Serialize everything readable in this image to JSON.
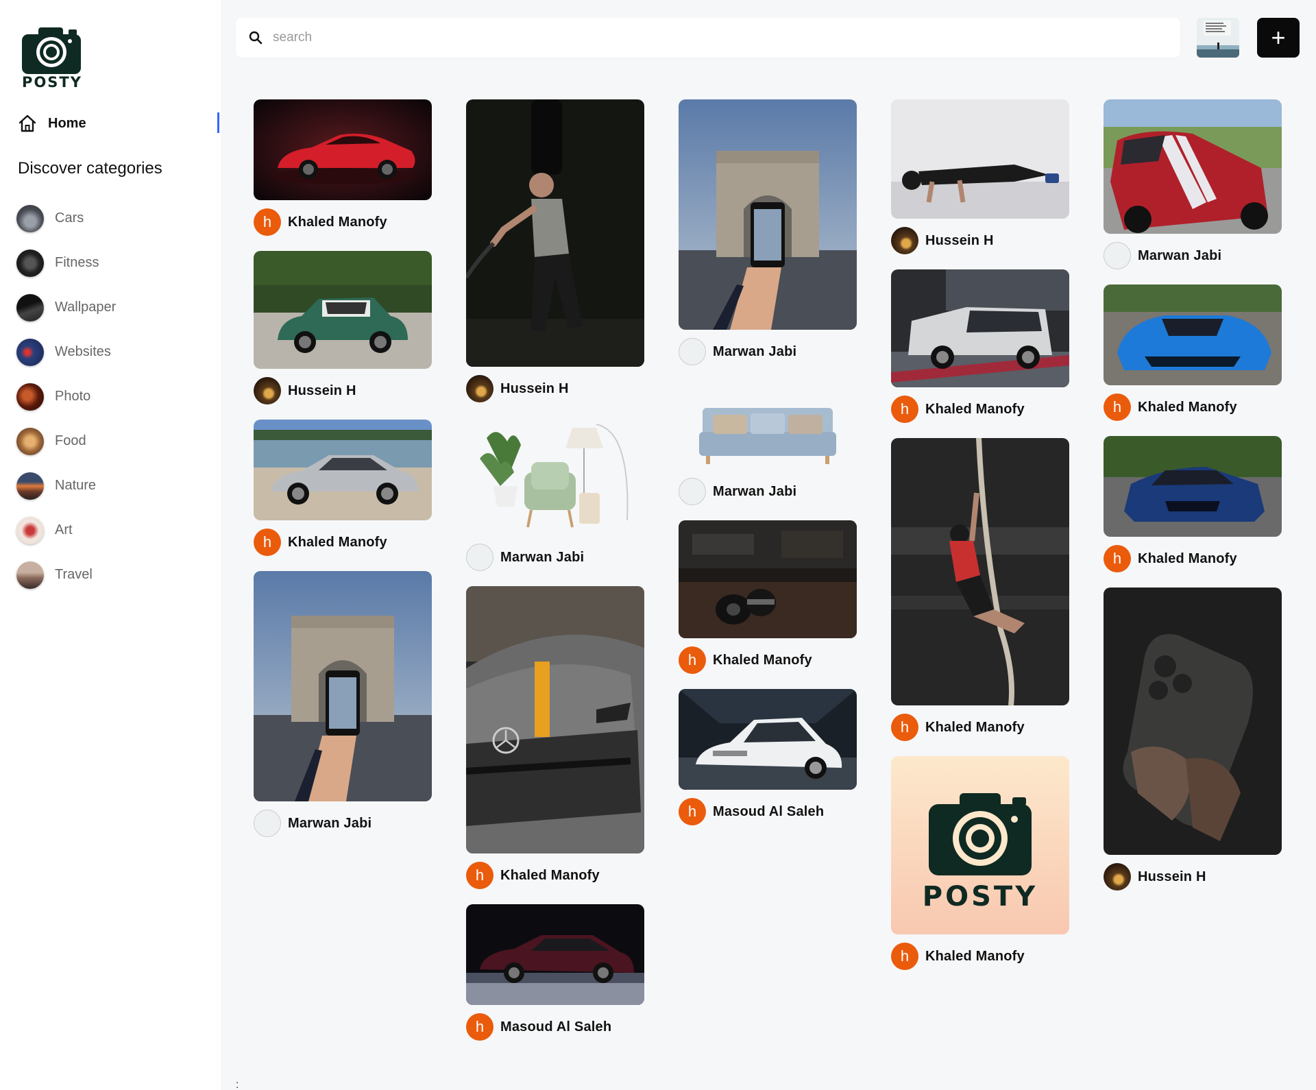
{
  "app": {
    "logo_text": "POSTY"
  },
  "sidebar": {
    "home_label": "Home",
    "discover_title": "Discover categories",
    "categories": [
      {
        "label": "Cars",
        "color": "#5b5f66"
      },
      {
        "label": "Fitness",
        "color": "#2a2a2a"
      },
      {
        "label": "Wallpaper",
        "color": "#3a3a3a"
      },
      {
        "label": "Websites",
        "color": "#2a3f7a"
      },
      {
        "label": "Photo",
        "color": "#6a2a1a"
      },
      {
        "label": "Food",
        "color": "#a06a3a"
      },
      {
        "label": "Nature",
        "color": "#b05a3a"
      },
      {
        "label": "Art",
        "color": "#c84a4a"
      },
      {
        "label": "Travel",
        "color": "#8a6a5a"
      }
    ]
  },
  "search": {
    "placeholder": "search"
  },
  "header": {
    "add_label": "+"
  },
  "footer": {
    "dots": ":"
  },
  "authors": {
    "khaled": "Khaled Manofy",
    "hussein": "Hussein H",
    "marwan": "Marwan Jabi",
    "masoud": "Masoud Al Saleh",
    "avatar_letter": "h"
  },
  "pins": [
    {
      "image": "red sports car",
      "author": "Khaled Manofy"
    },
    {
      "image": "green mini cooper",
      "author": "Hussein H"
    },
    {
      "image": "silver sedan by lake",
      "author": "Khaled Manofy"
    },
    {
      "image": "arc de triomphe phone photo",
      "author": "Marwan Jabi"
    },
    {
      "image": "man training with battle ropes",
      "author": "Hussein H"
    },
    {
      "image": "armchair with plants and lamp",
      "author": "Marwan Jabi"
    },
    {
      "image": "grey mercedes amg",
      "author": "Khaled Manofy"
    },
    {
      "image": "dark red cadillac",
      "author": "Masoud Al Saleh"
    },
    {
      "image": "arc de triomphe phone photo",
      "author": "Marwan Jabi"
    },
    {
      "image": "blue sofa",
      "author": "Marwan Jabi"
    },
    {
      "image": "dumbbells in gym",
      "author": "Khaled Manofy"
    },
    {
      "image": "white car in showroom",
      "author": "Masoud Al Saleh"
    },
    {
      "image": "man doing push ups",
      "author": "Hussein H"
    },
    {
      "image": "white kia soul",
      "author": "Khaled Manofy"
    },
    {
      "image": "man climbing rope",
      "author": "Khaled Manofy"
    },
    {
      "image": "posty logo",
      "author": "Khaled Manofy"
    },
    {
      "image": "red mustang",
      "author": "Marwan Jabi"
    },
    {
      "image": "blue mclaren",
      "author": "Khaled Manofy"
    },
    {
      "image": "blue cadillac",
      "author": "Khaled Manofy"
    },
    {
      "image": "hand holding iphone",
      "author": "Hussein H"
    }
  ]
}
